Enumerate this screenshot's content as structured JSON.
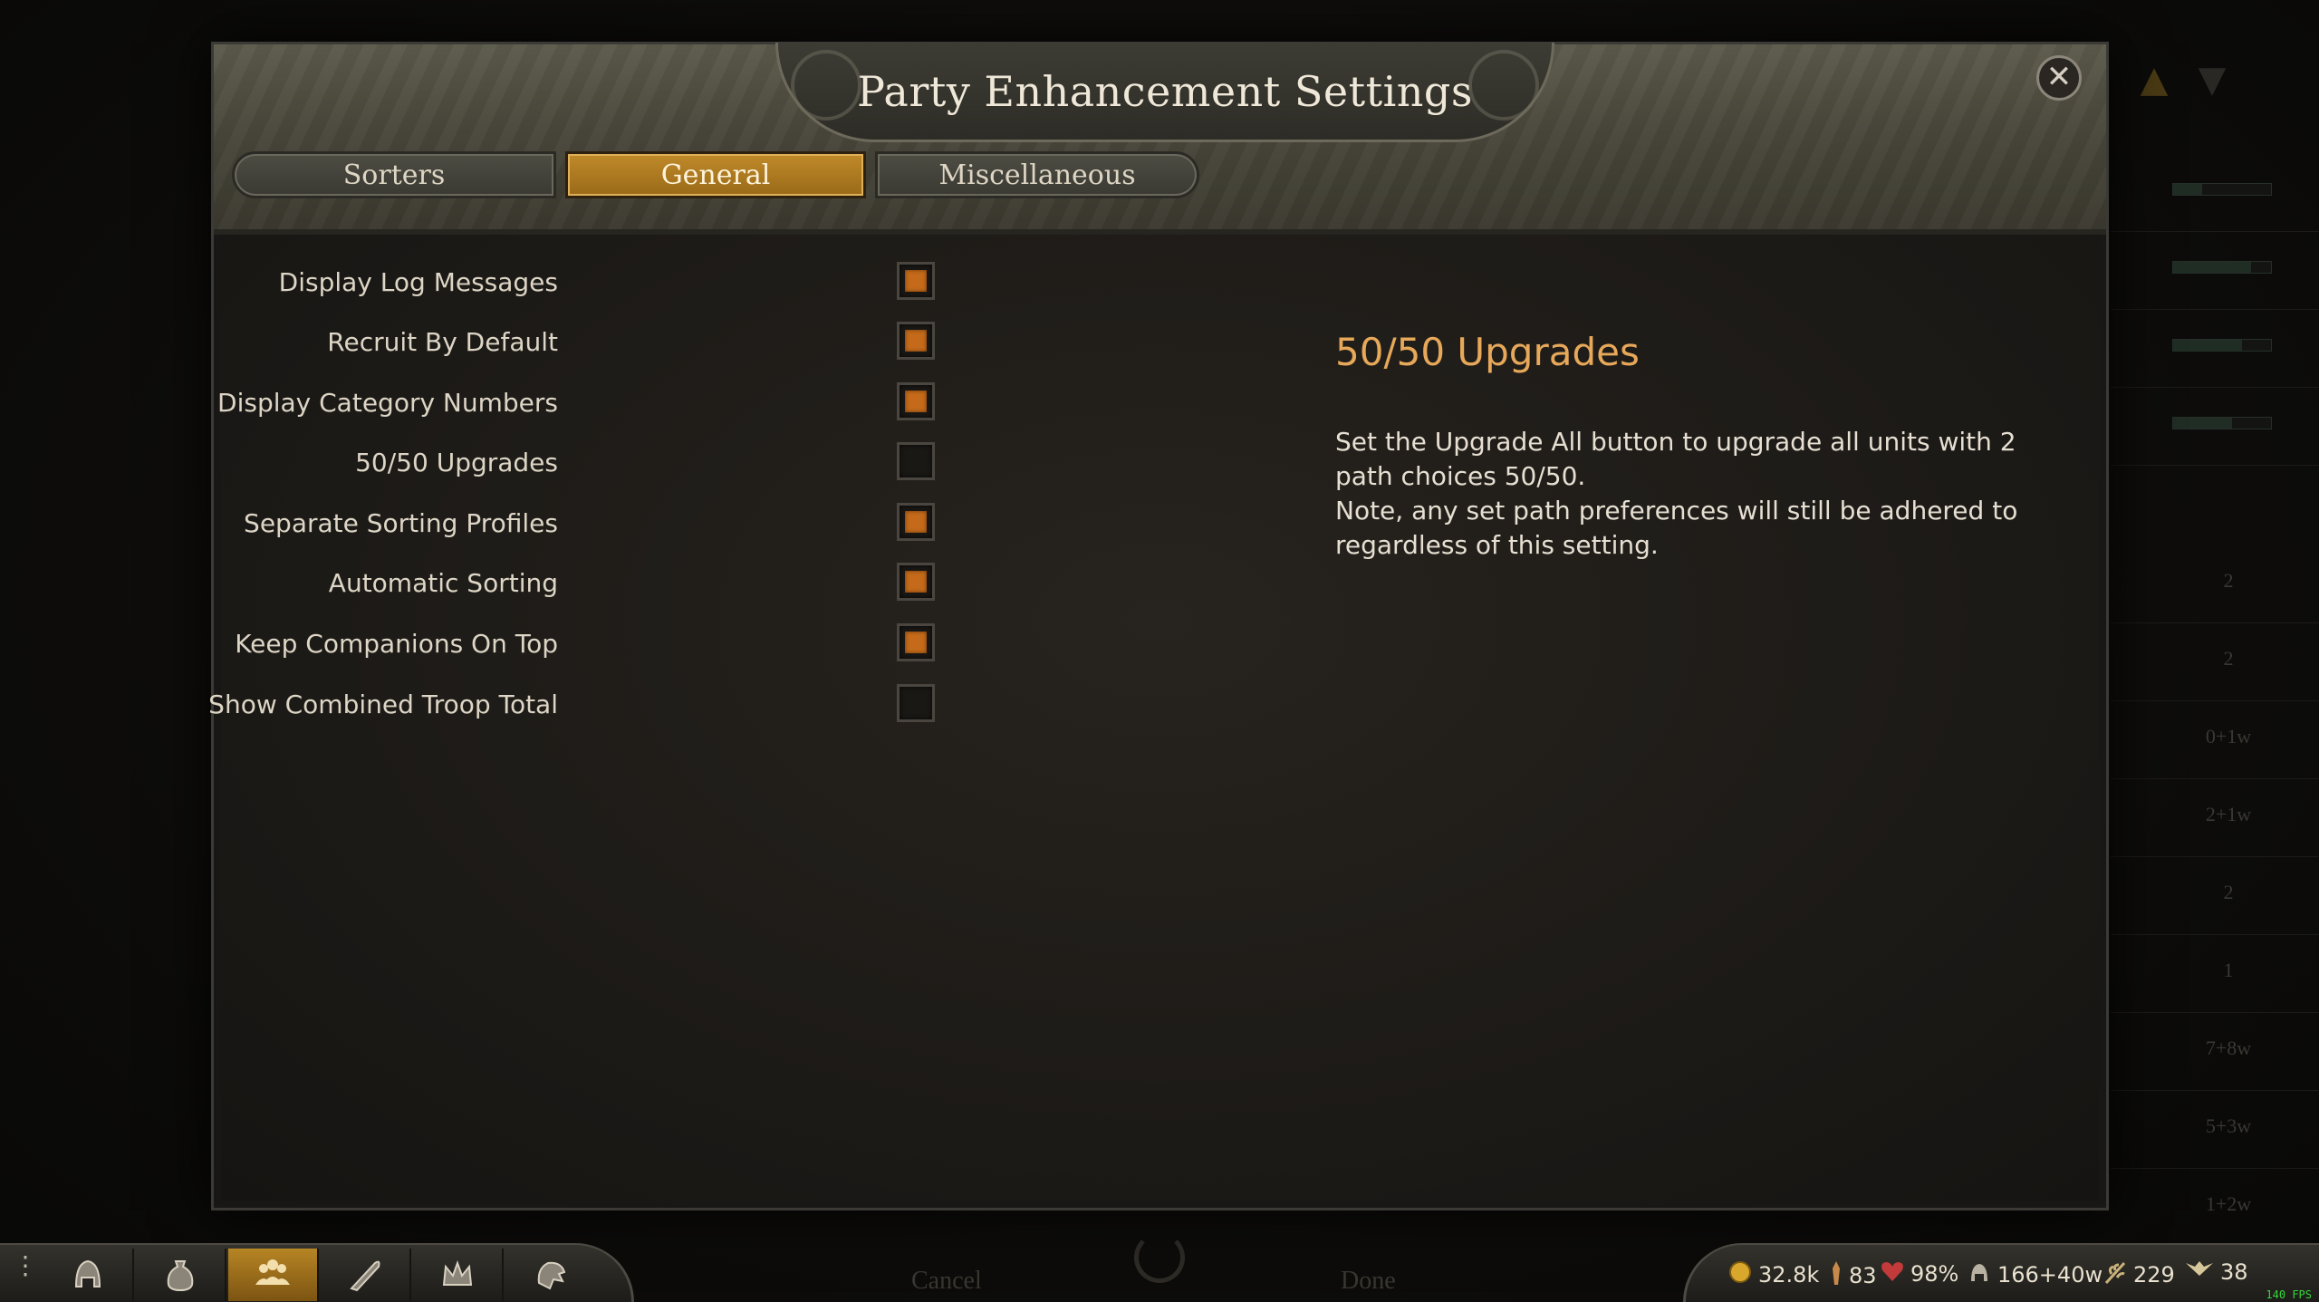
{
  "modal": {
    "title": "Party Enhancement Settings",
    "close_icon": "close-icon",
    "tabs": [
      {
        "label": "Sorters",
        "active": false
      },
      {
        "label": "General",
        "active": true
      },
      {
        "label": "Miscellaneous",
        "active": false
      }
    ],
    "options": [
      {
        "label": "Display Log Messages",
        "checked": true
      },
      {
        "label": "Recruit By Default",
        "checked": true
      },
      {
        "label": "Display Category Numbers",
        "checked": true
      },
      {
        "label": "50/50 Upgrades",
        "checked": false
      },
      {
        "label": "Separate Sorting Profiles",
        "checked": true
      },
      {
        "label": "Automatic Sorting",
        "checked": true
      },
      {
        "label": "Keep Companions On Top",
        "checked": true
      },
      {
        "label": "Show Combined Troop Total",
        "checked": false
      }
    ],
    "description": {
      "title": "50/50 Upgrades",
      "lines": [
        "Set the Upgrade All button to upgrade all units with 2 path choices 50/50.",
        "Note, any set path preferences will still be adhered to regardless of this setting."
      ]
    }
  },
  "background": {
    "cancel_label": "Cancel",
    "done_label": "Done",
    "right_values": [
      "2",
      "2",
      "0+1w",
      "2+1w",
      "2",
      "1",
      "7+8w",
      "5+3w",
      "1+2w"
    ],
    "bar_fills": [
      0.3,
      0.8,
      0.7,
      0.6
    ]
  },
  "bottom_nav": {
    "items": [
      {
        "name": "character-helmet-icon",
        "active": false
      },
      {
        "name": "inventory-bag-icon",
        "active": false
      },
      {
        "name": "party-troops-icon",
        "active": true
      },
      {
        "name": "quests-quill-icon",
        "active": false
      },
      {
        "name": "clan-crown-icon",
        "active": false
      },
      {
        "name": "kingdom-lion-icon",
        "active": false
      }
    ]
  },
  "status_bar": {
    "gold": "32.8k",
    "influence": "83",
    "morale": "98%",
    "troops": "166+40w",
    "food": "229",
    "speed": "38",
    "fps": "140 FPS"
  },
  "colors": {
    "accent_orange": "#c46a1a",
    "tab_active": "#b07a22",
    "desc_title": "#e7a85a",
    "fps_green": "#35d63b"
  }
}
